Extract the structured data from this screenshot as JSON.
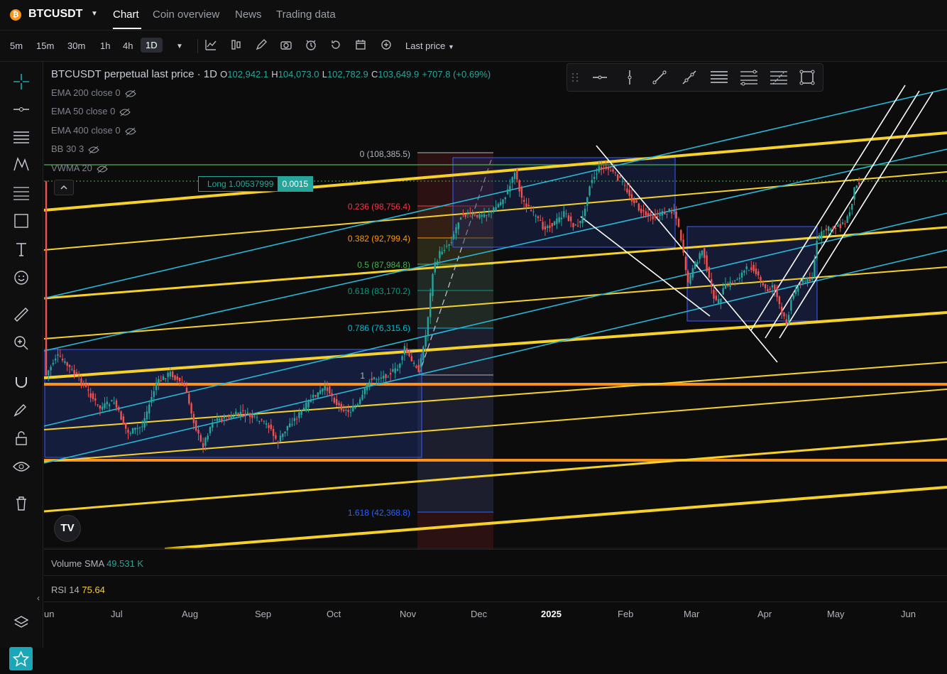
{
  "symbol": "BTCUSDT",
  "nav_tabs": [
    "Chart",
    "Coin overview",
    "News",
    "Trading data"
  ],
  "timeframes": [
    "5m",
    "15m",
    "30m",
    "1h",
    "4h",
    "1D"
  ],
  "active_timeframe": "1D",
  "price_type": "Last price",
  "legend": {
    "title": "BTCUSDT perpetual last price · 1D",
    "open_k": "O",
    "open_v": "102,942.1",
    "high_k": "H",
    "high_v": "104,073.0",
    "low_k": "L",
    "low_v": "102,782.9",
    "close_k": "C",
    "close_v": "103,649.9",
    "change": "+707.8 (+0.69%)"
  },
  "indicators": [
    "EMA 200 close 0",
    "EMA 50 close 0",
    "EMA 400 close 0",
    "BB 30 3",
    "VWMA 20"
  ],
  "position": {
    "label": "Long 1.00537999",
    "qty": "0.0015"
  },
  "fib_levels": [
    {
      "label": "0 (108,385.5)",
      "color": "#b2b5be"
    },
    {
      "label": "0.236 (98,756.4)",
      "color": "#f23645"
    },
    {
      "label": "0.382 (92,799.4)",
      "color": "#ff9800"
    },
    {
      "label": "0.5 (87,984.8)",
      "color": "#4caf50"
    },
    {
      "label": "0.618 (83,170.2)",
      "color": "#089981"
    },
    {
      "label": "0.786 (76,315.6)",
      "color": "#00bcd4"
    },
    {
      "label": "1",
      "color": "#b2b5be"
    },
    {
      "label": "1.618 (42,368.8)",
      "color": "#2962ff"
    }
  ],
  "volume_panel": {
    "label": "Volume SMA",
    "value": "49.531 K"
  },
  "rsi_panel": {
    "label": "RSI 14",
    "value": "75.64"
  },
  "x_axis": [
    "un",
    "Jul",
    "Aug",
    "Sep",
    "Oct",
    "Nov",
    "Dec",
    "2025",
    "Feb",
    "Mar",
    "Apr",
    "May",
    "Jun"
  ],
  "logo_text": "TV",
  "colors": {
    "up": "#26a69a",
    "down": "#ef5350",
    "accent": "#1aa8b8",
    "yellow": "#f5d12a",
    "orange": "#f7931a"
  }
}
